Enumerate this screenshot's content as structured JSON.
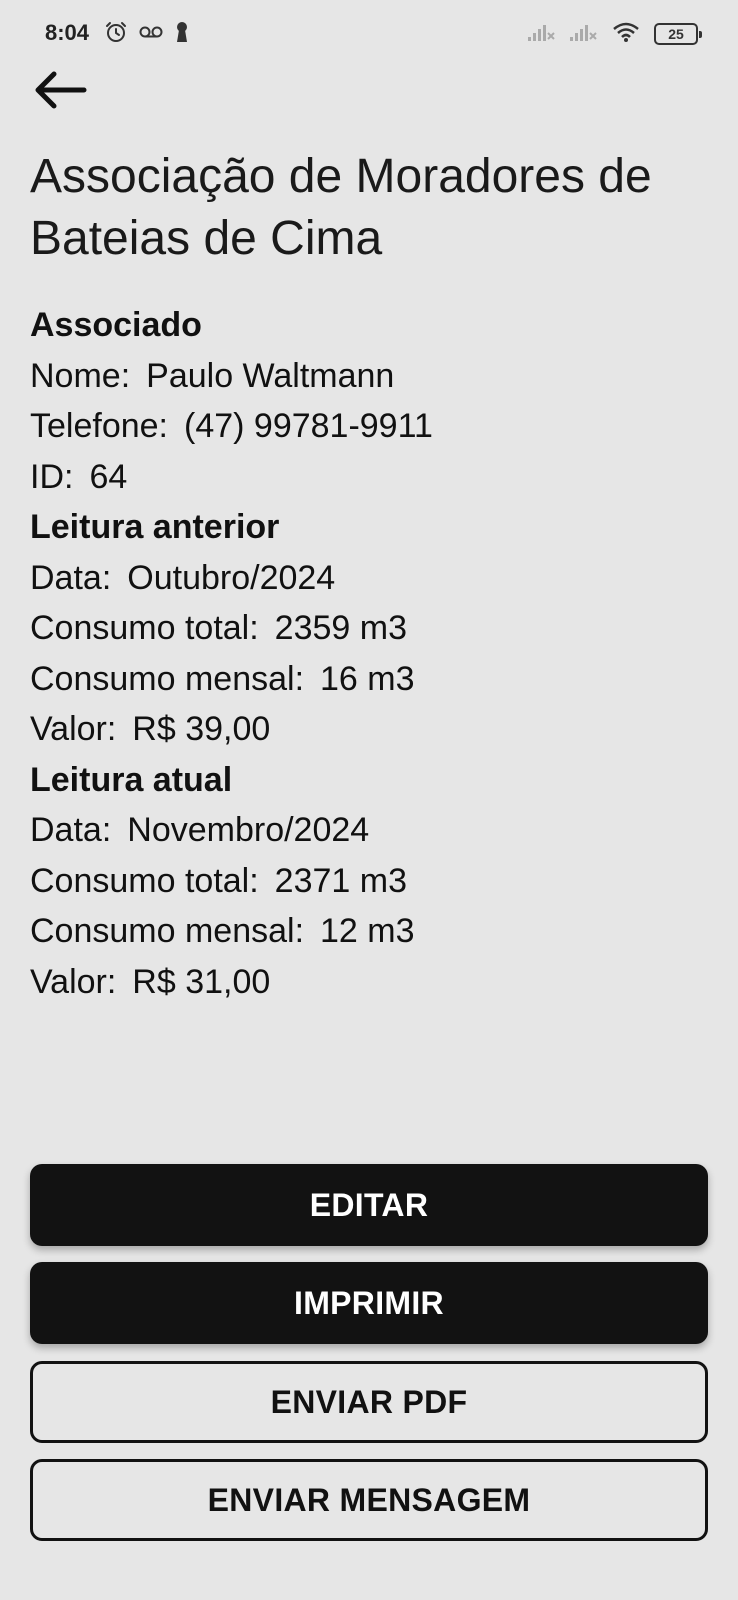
{
  "status_bar": {
    "time": "8:04",
    "battery": "25",
    "icons": [
      "alarm-icon",
      "voicemail-icon",
      "keyhole-icon",
      "signal-icon",
      "signal-icon",
      "wifi-icon",
      "battery-icon"
    ]
  },
  "header": {
    "back_icon": "arrow-left-icon",
    "title": "Associação de Moradores de Bateias de Cima"
  },
  "associado": {
    "heading": "Associado",
    "nome_label": "Nome:",
    "nome": "Paulo Waltmann",
    "telefone_label": "Telefone:",
    "telefone": "(47) 99781-9911",
    "id_label": "ID:",
    "id": "64"
  },
  "leitura_anterior": {
    "heading": "Leitura anterior",
    "data_label": "Data:",
    "data": "Outubro/2024",
    "consumo_total_label": "Consumo total:",
    "consumo_total": "2359 m3",
    "consumo_mensal_label": "Consumo mensal:",
    "consumo_mensal": "16 m3",
    "valor_label": "Valor:",
    "valor": "R$ 39,00"
  },
  "leitura_atual": {
    "heading": "Leitura atual",
    "data_label": "Data:",
    "data": "Novembro/2024",
    "consumo_total_label": "Consumo total:",
    "consumo_total": "2371 m3",
    "consumo_mensal_label": "Consumo mensal:",
    "consumo_mensal": "12 m3",
    "valor_label": "Valor:",
    "valor": "R$ 31,00"
  },
  "actions": {
    "editar": "EDITAR",
    "imprimir": "IMPRIMIR",
    "enviar_pdf": "ENVIAR PDF",
    "enviar_mensagem": "ENVIAR MENSAGEM"
  },
  "colors": {
    "background": "#e6e6e6",
    "primary": "#121212",
    "on_primary": "#ffffff"
  }
}
